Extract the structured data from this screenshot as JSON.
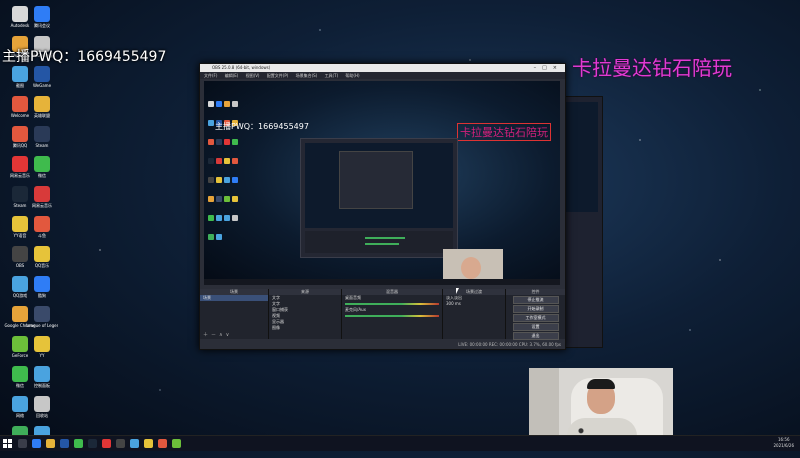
{
  "overlay": {
    "qq_text": "主播PWQ：1669455497",
    "title_text": "卡拉曼达钻石陪玩"
  },
  "desktop_icons": [
    {
      "label": "Autodesk",
      "color": "#d8d8d8"
    },
    {
      "label": "腾讯会议",
      "color": "#2f7df6"
    },
    {
      "label": "WeGame",
      "color": "#e6a33a"
    },
    {
      "label": "WeGame版",
      "color": "#c7c7c7"
    },
    {
      "label": "截图",
      "color": "#4aa3df"
    },
    {
      "label": "WeGame",
      "color": "#2456a5"
    },
    {
      "label": "Welcome",
      "color": "#e2583e"
    },
    {
      "label": "英雄联盟",
      "color": "#e6b33a"
    },
    {
      "label": "腾讯QQ",
      "color": "#e2583e"
    },
    {
      "label": "Steam",
      "color": "#2a3a57"
    },
    {
      "label": "网易云音乐",
      "color": "#e23636"
    },
    {
      "label": "微信",
      "color": "#3fbb4d"
    },
    {
      "label": "Steam",
      "color": "#1b2838"
    },
    {
      "label": "网易云音乐",
      "color": "#d83a3a"
    },
    {
      "label": "YY语音",
      "color": "#e6c33a"
    },
    {
      "label": "斗鱼",
      "color": "#e2583e"
    },
    {
      "label": "OBS",
      "color": "#444444"
    },
    {
      "label": "QQ音乐",
      "color": "#e6c33a"
    },
    {
      "label": "QQ游戏",
      "color": "#4aa3df"
    },
    {
      "label": "酷狗",
      "color": "#2f7df6"
    },
    {
      "label": "Google Chrome",
      "color": "#e6a33a"
    },
    {
      "label": "League of Legends",
      "color": "#3a4a6a"
    },
    {
      "label": "GeForce",
      "color": "#6cbf3a"
    },
    {
      "label": "YY",
      "color": "#e6c33a"
    },
    {
      "label": "微信",
      "color": "#3fbb4d"
    },
    {
      "label": "控制面板",
      "color": "#4aa3df"
    },
    {
      "label": "网络",
      "color": "#4aa3df"
    },
    {
      "label": "回收站",
      "color": "#c7c7c7"
    },
    {
      "label": "Google Play",
      "color": "#3fae5a"
    },
    {
      "label": "此电脑",
      "color": "#4aa3df"
    }
  ],
  "obs": {
    "title": "OBS 25.0.8 (64-bit, windows)",
    "menu": [
      "文件(F)",
      "编辑(E)",
      "视图(V)",
      "配置文件(P)",
      "场景集合(S)",
      "工具(T)",
      "帮助(H)"
    ],
    "preview": {
      "qq_text": "主播PWQ：1669455497",
      "title_text": "卡拉曼达钻石陪玩"
    },
    "docks": {
      "scenes": {
        "header": "场景",
        "items": [
          "场景"
        ]
      },
      "sources": {
        "header": "来源",
        "items": [
          "文字",
          "文字",
          "窗口捕获",
          "视频",
          "显示器",
          "图像"
        ]
      },
      "mixer": {
        "header": "混音器",
        "channels": [
          "桌面音频",
          "麦克风/Aux"
        ]
      },
      "transitions": {
        "header": "场景过渡",
        "value": "淡入淡出",
        "duration": "300 ms"
      },
      "controls": {
        "header": "控件",
        "buttons": [
          "停止推流",
          "开始录制",
          "工作室模式",
          "设置",
          "退出"
        ]
      }
    },
    "status": "LIVE: 00:00:00   REC: 00:00:00   CPU: 3.7%, 60.00 fps"
  },
  "taskbar": {
    "time": "16:56",
    "date": "2021/6/26"
  }
}
